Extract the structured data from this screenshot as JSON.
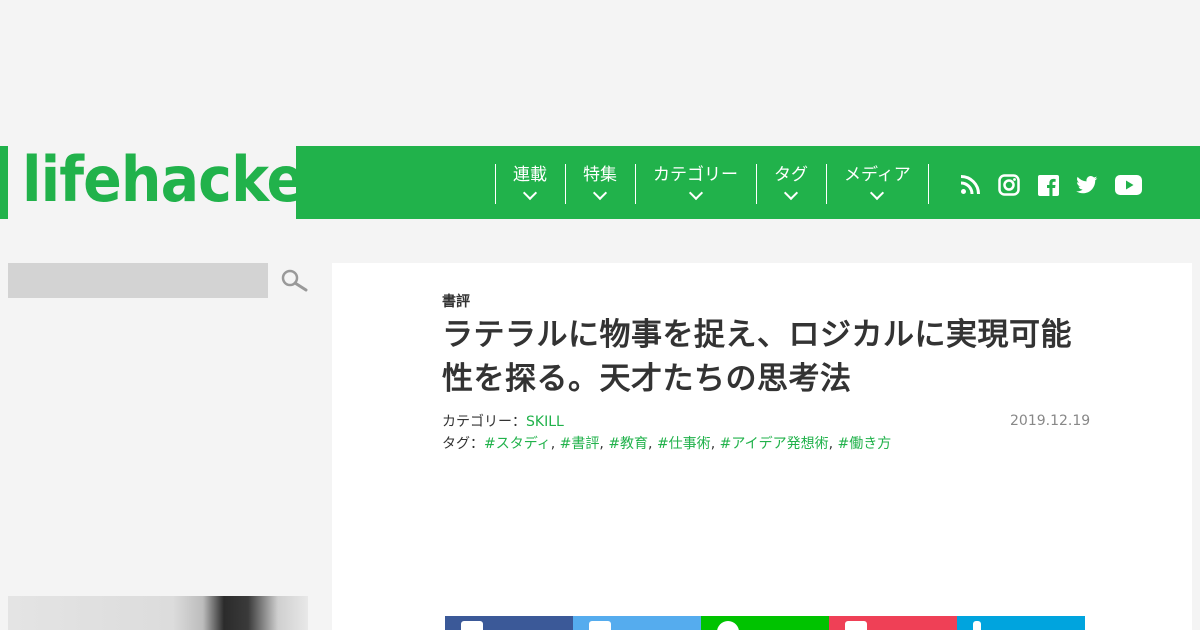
{
  "logo": {
    "text": "lifehacker"
  },
  "nav": {
    "items": [
      {
        "label": "連載"
      },
      {
        "label": "特集"
      },
      {
        "label": "カテゴリー"
      },
      {
        "label": "タグ"
      },
      {
        "label": "メディア"
      }
    ]
  },
  "social": [
    "rss-icon",
    "instagram-icon",
    "facebook-icon",
    "twitter-icon",
    "youtube-icon"
  ],
  "search": {
    "placeholder": ""
  },
  "article": {
    "category_label": "書評",
    "title": "ラテラルに物事を捉え、ロジカルに実現可能性を探る。天才たちの思考法",
    "category_prefix": "カテゴリー：",
    "category": "SKILL",
    "tags_prefix": "タグ：",
    "tags": [
      "#スタディ",
      "#書評",
      "#教育",
      "#仕事術",
      "#アイデア発想術",
      "#働き方"
    ],
    "date": "2019.12.19"
  },
  "share_buttons": [
    {
      "name": "facebook",
      "color": "#3b5998"
    },
    {
      "name": "twitter",
      "color": "#55acee"
    },
    {
      "name": "line",
      "color": "#00c300"
    },
    {
      "name": "pocket",
      "color": "#ef4056"
    },
    {
      "name": "hatena",
      "color": "#00a4de"
    }
  ],
  "colors": {
    "brand": "#21b24b",
    "background": "#f4f4f4"
  }
}
